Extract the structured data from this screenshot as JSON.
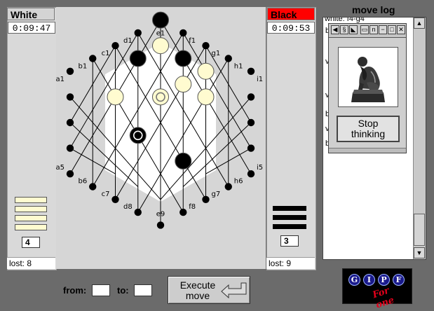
{
  "white_player": {
    "name": "White",
    "clock": "0:09:47",
    "reserve_count": "4",
    "reserve_pieces": 4,
    "lost_label": "lost: 8"
  },
  "black_player": {
    "name": "Black",
    "clock": "0:09:53",
    "reserve_count": "3",
    "reserve_pieces": 3,
    "lost_label": "lost: 9"
  },
  "board": {
    "labels": {
      "e9": "e9",
      "d8": "d8",
      "f8": "f8",
      "c7": "c7",
      "g7": "g7",
      "b6": "b6",
      "h6": "h6",
      "a5": "a5",
      "i5": "i5",
      "a1": "a1",
      "i1": "i1",
      "b1": "b1",
      "h1": "h1",
      "c1": "c1",
      "g1": "g1",
      "d1": "d1",
      "f1": "f1",
      "e1": "e1"
    },
    "colors": {
      "background": "#d6d6d6",
      "hexagon": "#ffffff",
      "white_piece": "#fffbd0",
      "black_piece": "#000000",
      "lines": "#000000"
    }
  },
  "move_log": {
    "title": "move log",
    "first_line": "white: f4-g4",
    "fragments": [
      "b",
      "v",
      "v",
      "b",
      "v",
      "b"
    ]
  },
  "popup": {
    "stop_line1": "Stop",
    "stop_line2": "thinking"
  },
  "controls": {
    "from_label": "from:",
    "to_label": "to:",
    "from_value": "",
    "to_value": "",
    "execute_line1": "Execute",
    "execute_line2": "move"
  },
  "logo": {
    "letters": [
      "G",
      "I",
      "P",
      "F"
    ],
    "subtitle": "For one"
  }
}
